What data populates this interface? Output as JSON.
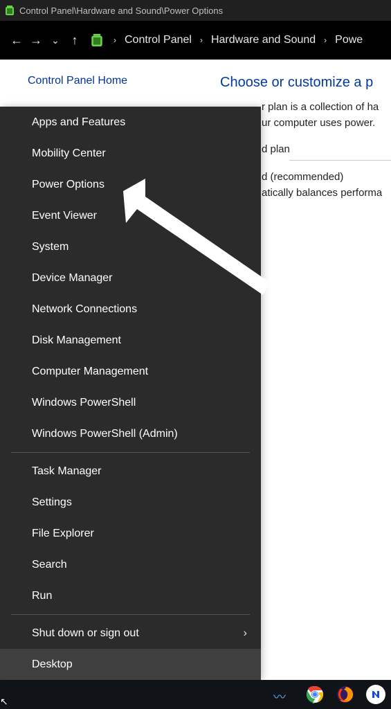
{
  "titlebar": {
    "title": "Control Panel\\Hardware and Sound\\Power Options"
  },
  "breadcrumb": {
    "items": [
      "Control Panel",
      "Hardware and Sound",
      "Powe"
    ]
  },
  "sidebar": {
    "home_link": "Control Panel Home"
  },
  "main": {
    "heading": "Choose or customize a p",
    "line1": "r plan is a collection of ha",
    "line2": "ur computer uses power.",
    "section_label": "d plan",
    "option_name": "d (recommended)",
    "option_desc": "atically balances performa"
  },
  "winx": {
    "group1": [
      "Apps and Features",
      "Mobility Center",
      "Power Options",
      "Event Viewer",
      "System",
      "Device Manager",
      "Network Connections",
      "Disk Management",
      "Computer Management",
      "Windows PowerShell",
      "Windows PowerShell (Admin)"
    ],
    "group2": [
      "Task Manager",
      "Settings",
      "File Explorer",
      "Search",
      "Run"
    ],
    "group3_shutdown": "Shut down or sign out",
    "group3_desktop": "Desktop"
  },
  "annotation": {
    "target": "Power Options"
  }
}
